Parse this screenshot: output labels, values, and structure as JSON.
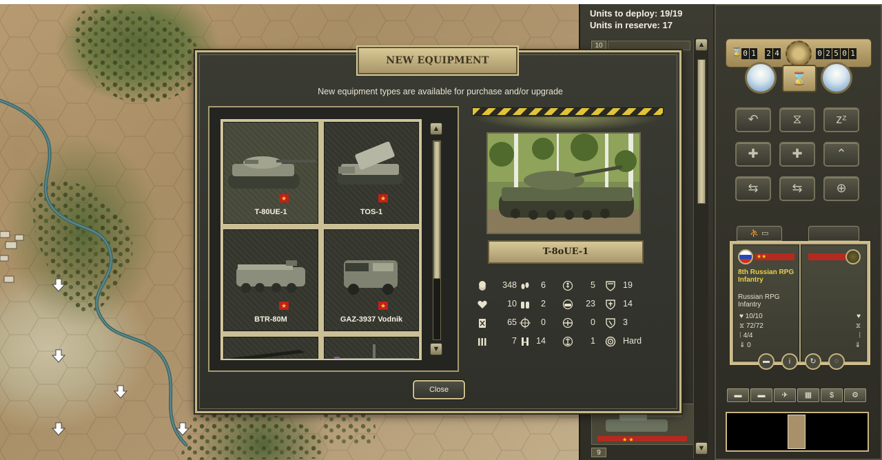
{
  "dialog": {
    "title": "NEW EQUIPMENT",
    "subtitle": "New equipment types are available for purchase and/or upgrade",
    "close_label": "Close",
    "units": [
      {
        "name": "T-80UE-1",
        "selected": true
      },
      {
        "name": "TOS-1",
        "selected": false
      },
      {
        "name": "BTR-80M",
        "selected": false
      },
      {
        "name": "GAZ-3937 Vodnik",
        "selected": false
      },
      {
        "name": "",
        "selected": false
      },
      {
        "name": "",
        "selected": false
      }
    ],
    "selected_name": "T-8oUE-1",
    "stats": [
      {
        "icon": "coins-icon",
        "value": "348"
      },
      {
        "icon": "footsteps-icon",
        "value": "6"
      },
      {
        "icon": "soft-target-icon",
        "value": "5"
      },
      {
        "icon": "shield-icon",
        "value": "19"
      },
      {
        "icon": "heart-icon",
        "value": "10"
      },
      {
        "icon": "binoculars-icon",
        "value": "2"
      },
      {
        "icon": "hard-target-icon",
        "value": "23"
      },
      {
        "icon": "shield-cross-icon",
        "value": "14"
      },
      {
        "icon": "fuel-icon",
        "value": "65"
      },
      {
        "icon": "crosshair-icon",
        "value": "0"
      },
      {
        "icon": "air-target-icon",
        "value": "0"
      },
      {
        "icon": "initiative-icon",
        "value": "3"
      },
      {
        "icon": "ammo-icon",
        "value": "7"
      },
      {
        "icon": "range-icon",
        "value": "14"
      },
      {
        "icon": "naval-target-icon",
        "value": "1"
      },
      {
        "icon": "target-type-icon",
        "value": "Hard"
      }
    ]
  },
  "deploy": {
    "units_to_deploy": "Units to deploy: 19/19",
    "units_in_reserve": "Units in reserve: 17",
    "slot_top": "10",
    "slot_bottom": "9"
  },
  "hud": {
    "turn_left": [
      "0",
      "1"
    ],
    "turn_right": [
      "2",
      "4"
    ],
    "prestige": [
      "0",
      "2",
      "5",
      "0",
      "1"
    ]
  },
  "unit_card": {
    "name": "8th Russian RPG Infantry",
    "type": "Russian RPG Infantry",
    "strength": "10/10",
    "fuel": "72/72",
    "ammo": "4/4",
    "experience": "0"
  },
  "colors": {
    "accent_gold": "#c7b988",
    "hazard_yellow": "#e1c439",
    "flag_red": "#c1201b"
  }
}
